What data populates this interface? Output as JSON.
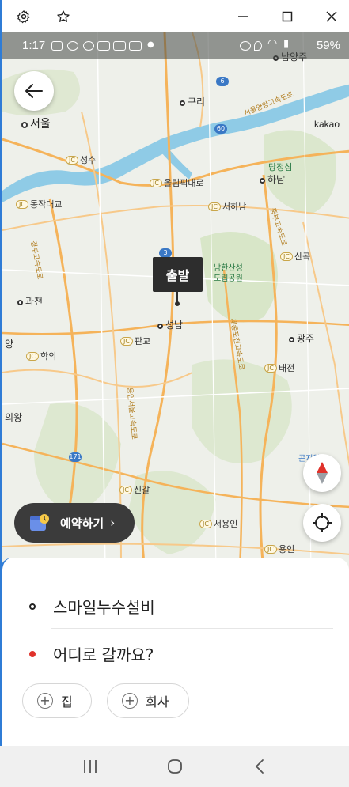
{
  "window": {
    "controls": [
      "gear-icon",
      "star-icon",
      "minimize-icon",
      "maximize-icon",
      "close-icon"
    ]
  },
  "status_bar": {
    "time": "1:17",
    "battery": "59%"
  },
  "map": {
    "brand": "kakao",
    "places": {
      "seoul": "서울",
      "guri": "구리",
      "namyangju": "남양주",
      "hanam": "하남",
      "dangjeongseom": "당정섬",
      "seongnam": "성남",
      "gwacheon": "과천",
      "gwangju": "광주",
      "uiwang": "의왕",
      "yang": "양",
      "namhansanseong": "남한산성\n도립공원",
      "gonjiam": "곤지암"
    },
    "junctions": {
      "seongsu": "성수",
      "olympic": "올림픽대로",
      "dongjak": "동작대교",
      "seohanam": "서하남",
      "sangok": "산곡",
      "pangyo": "판교",
      "hakui": "학의",
      "taejeon": "태전",
      "singal": "신갈",
      "seoyongin": "서용인",
      "yongin": "용인"
    },
    "road_badges": {
      "r6": "6",
      "r60": "60",
      "r171": "171",
      "r3": "3"
    },
    "road_names": {
      "gyeongbu": "경부고속도로",
      "seoul_yangyang": "서울양양고속도로",
      "jungbu": "중부고속도로",
      "sejong_pocheon": "세종포천고속도로",
      "yongin_seoul": "용인서울고속도로"
    },
    "pin_label": "출발"
  },
  "reserve_button": {
    "label": "예약하기",
    "chevron": "›"
  },
  "sheet": {
    "origin": "스마일누수설비",
    "destination_placeholder": "어디로 갈까요?",
    "chips": [
      {
        "label": "집"
      },
      {
        "label": "회사"
      }
    ]
  },
  "colors": {
    "route_origin_dot": "#222222",
    "route_destination_dot": "#e0322b",
    "river": "#5fb6d9",
    "highway": "#f5b35a",
    "accent": "#2f7cd6"
  }
}
